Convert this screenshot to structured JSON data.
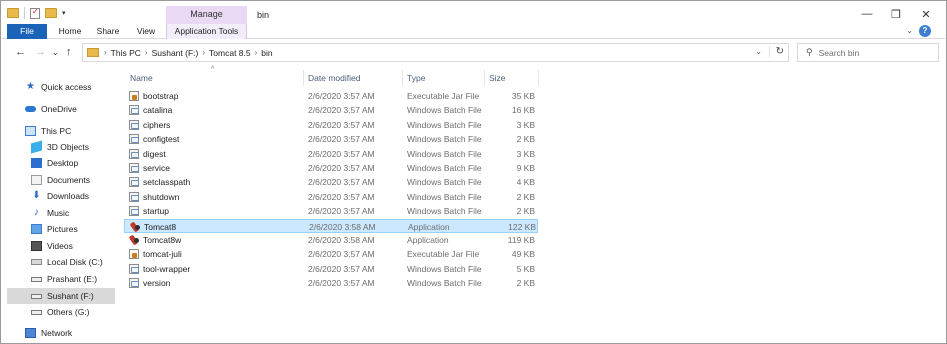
{
  "window": {
    "title": "bin",
    "context_tab": "Manage",
    "controls": {
      "minimize": "—",
      "maximize": "❐",
      "close": "✕"
    }
  },
  "ribbon": {
    "tabs": [
      "File",
      "Home",
      "Share",
      "View",
      "Application Tools"
    ],
    "help": "?",
    "expand": "⌄"
  },
  "navigation": {
    "back": "←",
    "forward": "→",
    "recent": "⌄",
    "up": "↑",
    "breadcrumb": [
      "This PC",
      "Sushant (F:)",
      "Tomcat 8.5",
      "bin"
    ],
    "crumb_separator": "›",
    "refresh": "↻",
    "search_placeholder": "Search bin"
  },
  "sidebar": {
    "items": [
      {
        "label": "Quick access",
        "icon": "star-icon"
      },
      {
        "label": "OneDrive",
        "icon": "cloud-icon"
      },
      {
        "label": "This PC",
        "icon": "computer-icon"
      },
      {
        "label": "3D Objects",
        "icon": "cube-icon"
      },
      {
        "label": "Desktop",
        "icon": "desktop-icon"
      },
      {
        "label": "Documents",
        "icon": "documents-icon"
      },
      {
        "label": "Downloads",
        "icon": "download-icon"
      },
      {
        "label": "Music",
        "icon": "music-icon"
      },
      {
        "label": "Pictures",
        "icon": "pictures-icon"
      },
      {
        "label": "Videos",
        "icon": "videos-icon"
      },
      {
        "label": "Local Disk (C:)",
        "icon": "drive-icon"
      },
      {
        "label": "Prashant (E:)",
        "icon": "drive-icon"
      },
      {
        "label": "Sushant (F:)",
        "icon": "drive-icon",
        "selected": true
      },
      {
        "label": "Others (G:)",
        "icon": "drive-icon"
      },
      {
        "label": "Network",
        "icon": "network-icon"
      }
    ]
  },
  "file_list": {
    "sort_indicator": "^",
    "columns": {
      "name": "Name",
      "date": "Date modified",
      "type": "Type",
      "size": "Size"
    },
    "files": [
      {
        "name": "bootstrap",
        "date": "2/6/2020 3:57 AM",
        "type": "Executable Jar File",
        "size": "35 KB",
        "icon": "jar"
      },
      {
        "name": "catalina",
        "date": "2/6/2020 3:57 AM",
        "type": "Windows Batch File",
        "size": "16 KB",
        "icon": "bat"
      },
      {
        "name": "ciphers",
        "date": "2/6/2020 3:57 AM",
        "type": "Windows Batch File",
        "size": "3 KB",
        "icon": "bat"
      },
      {
        "name": "configtest",
        "date": "2/6/2020 3:57 AM",
        "type": "Windows Batch File",
        "size": "2 KB",
        "icon": "bat"
      },
      {
        "name": "digest",
        "date": "2/6/2020 3:57 AM",
        "type": "Windows Batch File",
        "size": "3 KB",
        "icon": "bat"
      },
      {
        "name": "service",
        "date": "2/6/2020 3:57 AM",
        "type": "Windows Batch File",
        "size": "9 KB",
        "icon": "bat"
      },
      {
        "name": "setclasspath",
        "date": "2/6/2020 3:57 AM",
        "type": "Windows Batch File",
        "size": "4 KB",
        "icon": "bat"
      },
      {
        "name": "shutdown",
        "date": "2/6/2020 3:57 AM",
        "type": "Windows Batch File",
        "size": "2 KB",
        "icon": "bat"
      },
      {
        "name": "startup",
        "date": "2/6/2020 3:57 AM",
        "type": "Windows Batch File",
        "size": "2 KB",
        "icon": "bat"
      },
      {
        "name": "Tomcat8",
        "date": "2/6/2020 3:58 AM",
        "type": "Application",
        "size": "122 KB",
        "icon": "app",
        "selected": true
      },
      {
        "name": "Tomcat8w",
        "date": "2/6/2020 3:58 AM",
        "type": "Application",
        "size": "119 KB",
        "icon": "app"
      },
      {
        "name": "tomcat-juli",
        "date": "2/6/2020 3:57 AM",
        "type": "Executable Jar File",
        "size": "49 KB",
        "icon": "jar"
      },
      {
        "name": "tool-wrapper",
        "date": "2/6/2020 3:57 AM",
        "type": "Windows Batch File",
        "size": "5 KB",
        "icon": "bat"
      },
      {
        "name": "version",
        "date": "2/6/2020 3:57 AM",
        "type": "Windows Batch File",
        "size": "2 KB",
        "icon": "bat"
      }
    ]
  },
  "colors": {
    "file_tab": "#1a63b8",
    "manage_tab": "#ead9f5",
    "selection_fill": "#cce8ff",
    "selection_border": "#99d1ff",
    "sidebar_selected": "#d9d9d9"
  }
}
